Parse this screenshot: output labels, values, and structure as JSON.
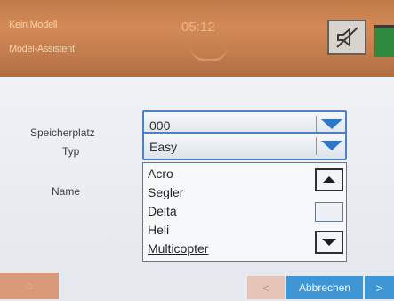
{
  "header": {
    "model_name": "Kein Modell",
    "screen_title": "Model-Assistent",
    "time": "05:12",
    "mute_icon": "speaker-muted-icon",
    "battery_icon": "battery-icon",
    "battery_color": "#2f8a3f"
  },
  "form": {
    "memory_slot": {
      "label": "Speicherplatz",
      "value": "000"
    },
    "type": {
      "label": "Typ",
      "value": "Easy"
    },
    "name": {
      "label": "Name"
    }
  },
  "type_list": {
    "items": [
      "Acro",
      "Segler",
      "Delta",
      "Heli",
      "Multicopter"
    ]
  },
  "footer": {
    "prev_label": "<",
    "cancel_label": "Abbrechen",
    "next_label": ">"
  },
  "colors": {
    "header": "#c88250",
    "accent": "#2f77c9",
    "button_blue": "#3f96d4"
  }
}
